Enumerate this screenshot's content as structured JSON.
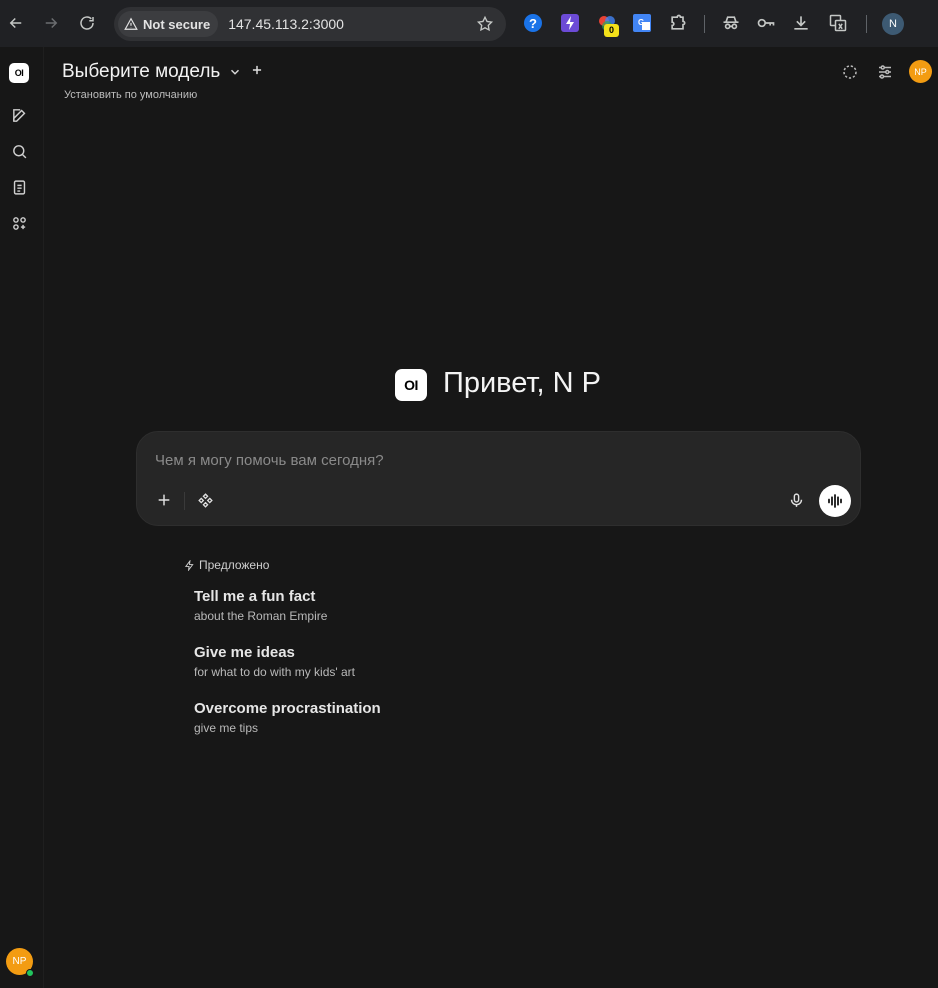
{
  "browser": {
    "security_label": "Not secure",
    "url": "147.45.113.2:3000",
    "extension_badge": "0",
    "profile_initial": "N"
  },
  "app": {
    "logo_text": "OI",
    "model_selector": "Выберите модель",
    "set_default": "Установить по умолчанию",
    "user_initials": "NP",
    "greeting": "Привет, N P",
    "input_placeholder": "Чем я могу помочь вам сегодня?",
    "suggested_label": "Предложено",
    "suggestions": [
      {
        "title": "Tell me a fun fact",
        "subtitle": "about the Roman Empire"
      },
      {
        "title": "Give me ideas",
        "subtitle": "for what to do with my kids' art"
      },
      {
        "title": "Overcome procrastination",
        "subtitle": "give me tips"
      }
    ]
  },
  "colors": {
    "background": "#171717",
    "input_bg": "#262626",
    "avatar": "#f39c12",
    "online": "#22c55e"
  }
}
